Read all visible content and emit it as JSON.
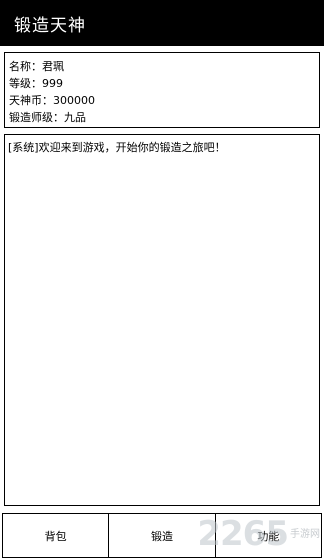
{
  "header": {
    "title": "锻造天神"
  },
  "player_info": {
    "name_label": "名称：",
    "name_value": "君珮",
    "level_label": "等级：",
    "level_value": "999",
    "currency_label": "天神币：",
    "currency_value": "300000",
    "smith_rank_label": "锻造师级：",
    "smith_rank_value": "九品"
  },
  "log": {
    "messages": [
      "[系统]欢迎来到游戏，开始你的锻造之旅吧！"
    ]
  },
  "bottom_nav": {
    "bag_label": "背包",
    "forge_label": "锻造",
    "function_label": "功能"
  },
  "watermark": {
    "number": "2265",
    "text": "手游网"
  }
}
